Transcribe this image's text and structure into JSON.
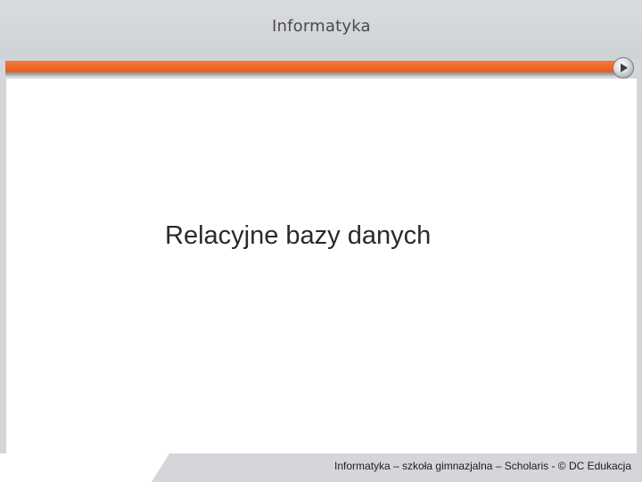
{
  "header": {
    "title": "Informatyka"
  },
  "slide": {
    "title": "Relacyjne bazy danych"
  },
  "footer": {
    "text": "Informatyka – szkoła gimnazjalna – Scholaris - © DC Edukacja"
  },
  "navigation": {
    "next_icon": "play-arrow-icon"
  },
  "colors": {
    "accent_orange": "#ec5a18",
    "background_gray": "#d4d6da",
    "content_white": "#ffffff"
  }
}
